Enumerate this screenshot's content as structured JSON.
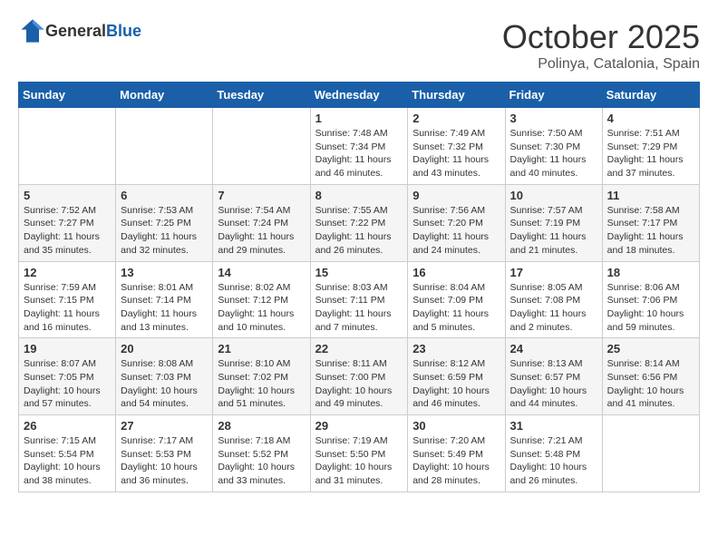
{
  "header": {
    "logo_general": "General",
    "logo_blue": "Blue",
    "month_title": "October 2025",
    "location": "Polinya, Catalonia, Spain"
  },
  "weekdays": [
    "Sunday",
    "Monday",
    "Tuesday",
    "Wednesday",
    "Thursday",
    "Friday",
    "Saturday"
  ],
  "weeks": [
    [
      {
        "day": "",
        "info": ""
      },
      {
        "day": "",
        "info": ""
      },
      {
        "day": "",
        "info": ""
      },
      {
        "day": "1",
        "info": "Sunrise: 7:48 AM\nSunset: 7:34 PM\nDaylight: 11 hours and 46 minutes."
      },
      {
        "day": "2",
        "info": "Sunrise: 7:49 AM\nSunset: 7:32 PM\nDaylight: 11 hours and 43 minutes."
      },
      {
        "day": "3",
        "info": "Sunrise: 7:50 AM\nSunset: 7:30 PM\nDaylight: 11 hours and 40 minutes."
      },
      {
        "day": "4",
        "info": "Sunrise: 7:51 AM\nSunset: 7:29 PM\nDaylight: 11 hours and 37 minutes."
      }
    ],
    [
      {
        "day": "5",
        "info": "Sunrise: 7:52 AM\nSunset: 7:27 PM\nDaylight: 11 hours and 35 minutes."
      },
      {
        "day": "6",
        "info": "Sunrise: 7:53 AM\nSunset: 7:25 PM\nDaylight: 11 hours and 32 minutes."
      },
      {
        "day": "7",
        "info": "Sunrise: 7:54 AM\nSunset: 7:24 PM\nDaylight: 11 hours and 29 minutes."
      },
      {
        "day": "8",
        "info": "Sunrise: 7:55 AM\nSunset: 7:22 PM\nDaylight: 11 hours and 26 minutes."
      },
      {
        "day": "9",
        "info": "Sunrise: 7:56 AM\nSunset: 7:20 PM\nDaylight: 11 hours and 24 minutes."
      },
      {
        "day": "10",
        "info": "Sunrise: 7:57 AM\nSunset: 7:19 PM\nDaylight: 11 hours and 21 minutes."
      },
      {
        "day": "11",
        "info": "Sunrise: 7:58 AM\nSunset: 7:17 PM\nDaylight: 11 hours and 18 minutes."
      }
    ],
    [
      {
        "day": "12",
        "info": "Sunrise: 7:59 AM\nSunset: 7:15 PM\nDaylight: 11 hours and 16 minutes."
      },
      {
        "day": "13",
        "info": "Sunrise: 8:01 AM\nSunset: 7:14 PM\nDaylight: 11 hours and 13 minutes."
      },
      {
        "day": "14",
        "info": "Sunrise: 8:02 AM\nSunset: 7:12 PM\nDaylight: 11 hours and 10 minutes."
      },
      {
        "day": "15",
        "info": "Sunrise: 8:03 AM\nSunset: 7:11 PM\nDaylight: 11 hours and 7 minutes."
      },
      {
        "day": "16",
        "info": "Sunrise: 8:04 AM\nSunset: 7:09 PM\nDaylight: 11 hours and 5 minutes."
      },
      {
        "day": "17",
        "info": "Sunrise: 8:05 AM\nSunset: 7:08 PM\nDaylight: 11 hours and 2 minutes."
      },
      {
        "day": "18",
        "info": "Sunrise: 8:06 AM\nSunset: 7:06 PM\nDaylight: 10 hours and 59 minutes."
      }
    ],
    [
      {
        "day": "19",
        "info": "Sunrise: 8:07 AM\nSunset: 7:05 PM\nDaylight: 10 hours and 57 minutes."
      },
      {
        "day": "20",
        "info": "Sunrise: 8:08 AM\nSunset: 7:03 PM\nDaylight: 10 hours and 54 minutes."
      },
      {
        "day": "21",
        "info": "Sunrise: 8:10 AM\nSunset: 7:02 PM\nDaylight: 10 hours and 51 minutes."
      },
      {
        "day": "22",
        "info": "Sunrise: 8:11 AM\nSunset: 7:00 PM\nDaylight: 10 hours and 49 minutes."
      },
      {
        "day": "23",
        "info": "Sunrise: 8:12 AM\nSunset: 6:59 PM\nDaylight: 10 hours and 46 minutes."
      },
      {
        "day": "24",
        "info": "Sunrise: 8:13 AM\nSunset: 6:57 PM\nDaylight: 10 hours and 44 minutes."
      },
      {
        "day": "25",
        "info": "Sunrise: 8:14 AM\nSunset: 6:56 PM\nDaylight: 10 hours and 41 minutes."
      }
    ],
    [
      {
        "day": "26",
        "info": "Sunrise: 7:15 AM\nSunset: 5:54 PM\nDaylight: 10 hours and 38 minutes."
      },
      {
        "day": "27",
        "info": "Sunrise: 7:17 AM\nSunset: 5:53 PM\nDaylight: 10 hours and 36 minutes."
      },
      {
        "day": "28",
        "info": "Sunrise: 7:18 AM\nSunset: 5:52 PM\nDaylight: 10 hours and 33 minutes."
      },
      {
        "day": "29",
        "info": "Sunrise: 7:19 AM\nSunset: 5:50 PM\nDaylight: 10 hours and 31 minutes."
      },
      {
        "day": "30",
        "info": "Sunrise: 7:20 AM\nSunset: 5:49 PM\nDaylight: 10 hours and 28 minutes."
      },
      {
        "day": "31",
        "info": "Sunrise: 7:21 AM\nSunset: 5:48 PM\nDaylight: 10 hours and 26 minutes."
      },
      {
        "day": "",
        "info": ""
      }
    ]
  ]
}
